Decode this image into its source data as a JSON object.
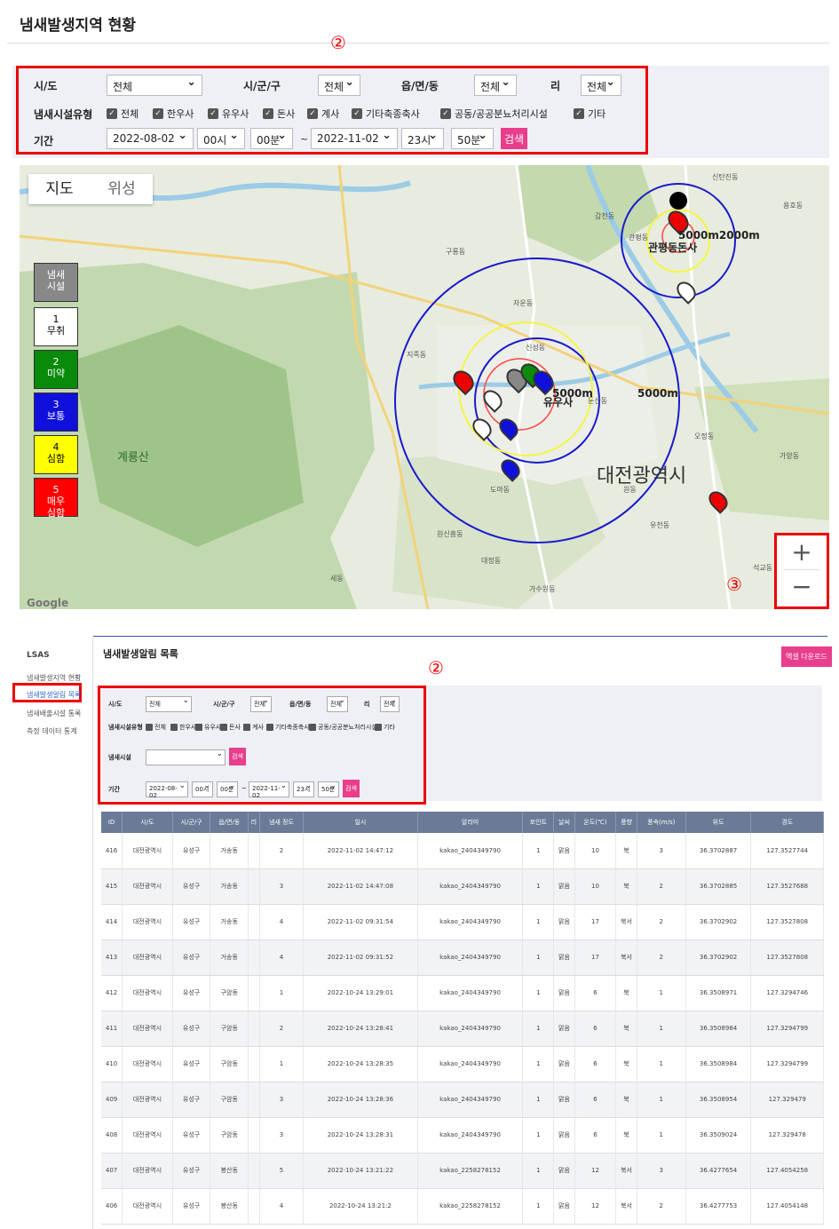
{
  "top": {
    "title": "냄새발생지역 현황",
    "marker2": "②",
    "marker3": "③",
    "filter": {
      "sido_label": "시/도",
      "sido_value": "전체",
      "sigungu_label": "시/군/구",
      "sigungu_value": "전체",
      "emd_label": "읍/면/동",
      "emd_value": "전체",
      "ri_label": "리",
      "ri_value": "전체",
      "type_label": "냄새시설유형",
      "types": [
        "전체",
        "한우사",
        "유우사",
        "돈사",
        "계사",
        "기타축종축사",
        "공동/공공분뇨처리시설",
        "기타"
      ],
      "period_label": "기간",
      "start_date": "2022-08-02",
      "start_hour": "00시",
      "start_min": "00분",
      "tilde": "~",
      "end_date": "2022-11-02",
      "end_hour": "23시",
      "end_min": "50분",
      "search_label": "검색"
    },
    "map": {
      "tab_map": "지도",
      "tab_satellite": "위성",
      "legend": [
        {
          "num": "",
          "label": "냄새\n시설",
          "color": "#888888",
          "text": "#fff"
        },
        {
          "num": "1",
          "label": "무취",
          "color": "#ffffff",
          "text": "#000"
        },
        {
          "num": "2",
          "label": "미약",
          "color": "#0a8a0a",
          "text": "#fff"
        },
        {
          "num": "3",
          "label": "보통",
          "color": "#1010dd",
          "text": "#fff"
        },
        {
          "num": "4",
          "label": "심함",
          "color": "#ffff00",
          "text": "#000"
        },
        {
          "num": "5",
          "label": "매우\n심함",
          "color": "#ff0000",
          "text": "#fff"
        }
      ],
      "city_label": "대전광역시",
      "mountain_label": "계룡산",
      "label_5000m_1": "5000m",
      "label_5000m_2": "5000m",
      "label_cluster": "5000m2000m",
      "label_gwanpyeong": "관평동돈사",
      "label_yusa": "유우사",
      "place_labels": [
        "신탄진동",
        "갑천동",
        "용호동",
        "관평동",
        "구룡동",
        "자운동",
        "신성동",
        "지족동",
        "원신흥동",
        "대정동",
        "대전광역시",
        "유천동",
        "둔산동",
        "석교동",
        "가수원동",
        "세동",
        "도마동",
        "오정동",
        "가양동",
        "원동"
      ],
      "zoom_in": "+",
      "zoom_out": "−",
      "google": "Google"
    }
  },
  "bottom": {
    "brand": "LSAS",
    "menu": [
      "냄새발생지역 현황",
      "냄새발생알림 목록",
      "냄새배출시설 통록",
      "측정 데이터 통계"
    ],
    "title": "냄새발생알림 목록",
    "excel_button": "엑셀 다운로드",
    "marker2": "②",
    "filter": {
      "sido_label": "시/도",
      "sido_value": "전체",
      "sigungu_label": "시/군/구",
      "sigungu_value": "전체",
      "emd_label": "읍/면/동",
      "emd_value": "전체",
      "ri_label": "리",
      "ri_value": "전체",
      "type_label": "냄새시설유형",
      "types": [
        "전체",
        "한우사",
        "유우사",
        "돈사",
        "계사",
        "기타축종축사",
        "공동/공공분뇨처리시설",
        "기타"
      ],
      "facility_label": "냄새시설",
      "facility_value": "",
      "search_label": "검색",
      "period_label": "기간",
      "start_date": "2022-08-02",
      "start_hour": "00시",
      "start_min": "00분",
      "tilde": "~",
      "end_date": "2022-11-02",
      "end_hour": "23시",
      "end_min": "50분"
    },
    "table": {
      "headers": [
        "ID",
        "시/도",
        "시/군/구",
        "읍/면/동",
        "리",
        "냄새 정도",
        "일시",
        "알리미",
        "포인트",
        "날씨",
        "온도(℃)",
        "풍향",
        "풍속(m/s)",
        "위도",
        "경도"
      ],
      "rows": [
        [
          "416",
          "대전광역시",
          "유성구",
          "거송동",
          "",
          "2",
          "2022-11-02 14:47:12",
          "kakao_2404349790",
          "1",
          "맑음",
          "10",
          "북",
          "3",
          "36.3702887",
          "127.3527744"
        ],
        [
          "415",
          "대전광역시",
          "유성구",
          "거송동",
          "",
          "3",
          "2022-11-02 14:47:08",
          "kakao_2404349790",
          "1",
          "맑음",
          "10",
          "북",
          "2",
          "36.3702885",
          "127.3527688"
        ],
        [
          "414",
          "대전광역시",
          "유성구",
          "거송동",
          "",
          "4",
          "2022-11-02 09:31:54",
          "kakao_2404349790",
          "1",
          "맑음",
          "17",
          "북서",
          "2",
          "36.3702902",
          "127.3527808"
        ],
        [
          "413",
          "대전광역시",
          "유성구",
          "거송동",
          "",
          "4",
          "2022-11-02 09:31:52",
          "kakao_2404349790",
          "1",
          "맑음",
          "17",
          "북서",
          "2",
          "36.3702902",
          "127.3527808"
        ],
        [
          "412",
          "대전광역시",
          "유성구",
          "구암동",
          "",
          "1",
          "2022-10-24 13:29:01",
          "kakao_2404349790",
          "1",
          "맑음",
          "6",
          "북",
          "1",
          "36.3508971",
          "127.3294746"
        ],
        [
          "411",
          "대전광역시",
          "유성구",
          "구암동",
          "",
          "2",
          "2022-10-24 13:28:41",
          "kakao_2404349790",
          "1",
          "맑음",
          "6",
          "북",
          "1",
          "36.3508984",
          "127.3294799"
        ],
        [
          "410",
          "대전광역시",
          "유성구",
          "구암동",
          "",
          "1",
          "2022-10-24 13:28:35",
          "kakao_2404349790",
          "1",
          "맑음",
          "6",
          "북",
          "1",
          "36.3508984",
          "127.3294799"
        ],
        [
          "409",
          "대전광역시",
          "유성구",
          "구암동",
          "",
          "3",
          "2022-10-24 13:28:36",
          "kakao_2404349790",
          "1",
          "맑음",
          "6",
          "북",
          "1",
          "36.3508954",
          "127.329479"
        ],
        [
          "408",
          "대전광역시",
          "유성구",
          "구암동",
          "",
          "3",
          "2022-10-24 13:28:31",
          "kakao_2404349790",
          "1",
          "맑음",
          "6",
          "북",
          "1",
          "36.3509024",
          "127.329478"
        ],
        [
          "407",
          "대전광역시",
          "유성구",
          "봉산동",
          "",
          "5",
          "2022-10-24 13:21:22",
          "kakao_2258278152",
          "1",
          "맑음",
          "12",
          "북서",
          "3",
          "36.4277654",
          "127.4054258"
        ],
        [
          "406",
          "대전광역시",
          "유성구",
          "봉산동",
          "",
          "4",
          "2022-10-24 13:21:2",
          "kakao_2258278152",
          "1",
          "맑음",
          "12",
          "북서",
          "2",
          "36.4277753",
          "127.4054148"
        ]
      ]
    }
  },
  "colors": {
    "accent_red": "#e00000",
    "search_pink": "#e83e8c",
    "table_header": "#6b7a96"
  }
}
